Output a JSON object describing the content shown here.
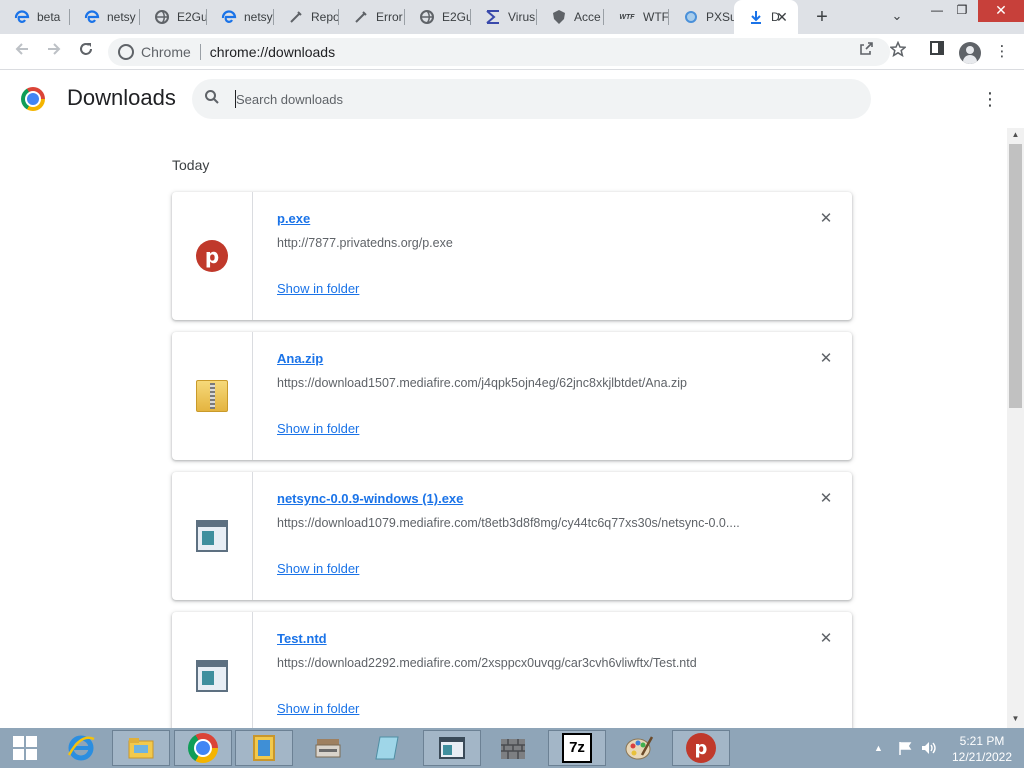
{
  "browser": {
    "tabs": [
      {
        "label": "beta",
        "icon": "edge-icon",
        "color": "#1a73e8"
      },
      {
        "label": "netsy",
        "icon": "edge-icon",
        "color": "#1a73e8"
      },
      {
        "label": "E2Gu",
        "icon": "globe-icon",
        "color": "#5f6368"
      },
      {
        "label": "netsy",
        "icon": "edge-icon",
        "color": "#1a73e8"
      },
      {
        "label": "Repo",
        "icon": "wrench-icon",
        "color": "#5f6368"
      },
      {
        "label": "Error",
        "icon": "wrench-icon",
        "color": "#5f6368"
      },
      {
        "label": "E2Gu",
        "icon": "globe-icon",
        "color": "#5f6368"
      },
      {
        "label": "Virus",
        "icon": "virustotal-icon",
        "color": "#3949ab"
      },
      {
        "label": "Acce",
        "icon": "shield-icon",
        "color": "#5f6368"
      },
      {
        "label": "WTF",
        "icon": "wtf-icon",
        "color": "#202124"
      },
      {
        "label": "PXSu",
        "icon": "globe-icon",
        "color": "#4a90d9"
      },
      {
        "label": "D",
        "icon": "download-icon",
        "color": "#1a73e8",
        "active": true
      }
    ],
    "new_tab_symbol": "+",
    "tab_search_symbol": "⌄",
    "window_controls": {
      "minimize": "—",
      "restore": "❐",
      "close": "✕"
    },
    "omnibox": {
      "chip": "Chrome",
      "url": "chrome://downloads"
    }
  },
  "downloads_page": {
    "title": "Downloads",
    "search": {
      "placeholder": "Search downloads"
    },
    "section": "Today",
    "show_in_folder_label": "Show in folder",
    "items": [
      {
        "name": "p.exe",
        "url": "http://7877.privatedns.org/p.exe",
        "icon": "psiphon-icon"
      },
      {
        "name": "Ana.zip",
        "url": "https://download1507.mediafire.com/j4qpk5ojn4eg/62jnc8xkjlbtdet/Ana.zip",
        "icon": "zip-folder-icon"
      },
      {
        "name": "netsync-0.0.9-windows (1).exe",
        "url": "https://download1079.mediafire.com/t8etb3d8f8mg/cy44tc6q77xs30s/netsync-0.0....",
        "icon": "app-window-icon"
      },
      {
        "name": "Test.ntd",
        "url": "https://download2292.mediafire.com/2xsppcx0uvqg/car3cvh6vliwftx/Test.ntd",
        "icon": "app-window-icon"
      }
    ]
  },
  "taskbar": {
    "apps": [
      {
        "icon": "internet-explorer-icon"
      },
      {
        "icon": "file-explorer-icon"
      },
      {
        "icon": "chrome-icon"
      },
      {
        "icon": "framed-app-icon"
      },
      {
        "icon": "scanner-icon"
      },
      {
        "icon": "notebook-icon"
      },
      {
        "icon": "app-window-icon"
      },
      {
        "icon": "firewall-icon"
      },
      {
        "icon": "7zip-icon",
        "label": "7z"
      },
      {
        "icon": "paint-palette-icon"
      },
      {
        "icon": "psiphon-icon",
        "label": "p"
      }
    ],
    "clock": {
      "time": "5:21 PM",
      "date": "12/21/2022"
    }
  }
}
